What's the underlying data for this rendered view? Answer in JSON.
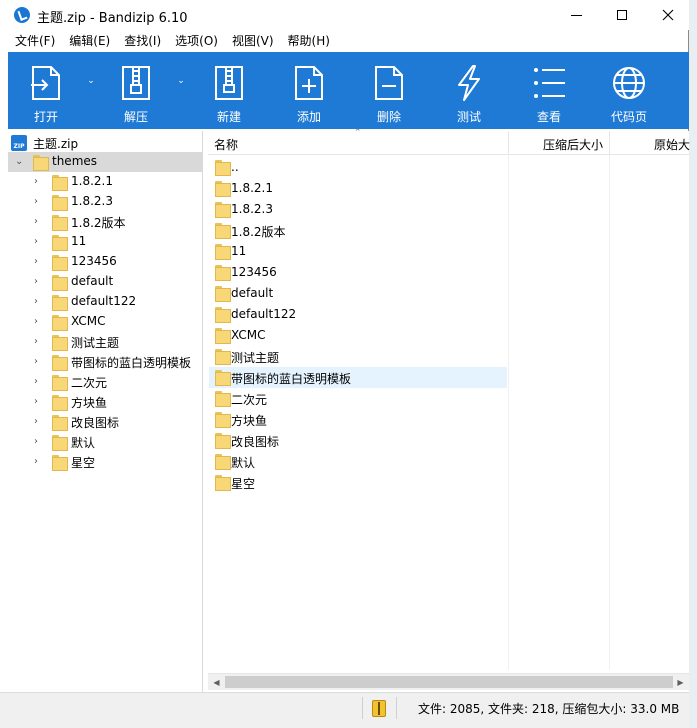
{
  "window": {
    "title": "主题.zip - Bandizip 6.10"
  },
  "menu": [
    "文件(F)",
    "编辑(E)",
    "查找(I)",
    "选项(O)",
    "视图(V)",
    "帮助(H)"
  ],
  "toolbar": {
    "open": "打开",
    "extract": "解压",
    "new": "新建",
    "add": "添加",
    "delete": "删除",
    "test": "测试",
    "view": "查看",
    "codepage": "代码页"
  },
  "tree": {
    "root": "主题.zip",
    "folder": "themes",
    "children": [
      "1.8.2.1",
      "1.8.2.3",
      "1.8.2版本",
      "11",
      "123456",
      "default",
      "default122",
      "XCMC",
      "测试主题",
      "带图标的蓝白透明模板",
      "二次元",
      "方块鱼",
      "改良图标",
      "默认",
      "星空"
    ]
  },
  "list": {
    "columns": {
      "name": "名称",
      "packed_size": "压缩后大小",
      "original_size": "原始大"
    },
    "rows": [
      "..",
      "1.8.2.1",
      "1.8.2.3",
      "1.8.2版本",
      "11",
      "123456",
      "default",
      "default122",
      "XCMC",
      "测试主题",
      "带图标的蓝白透明模板",
      "二次元",
      "方块鱼",
      "改良图标",
      "默认",
      "星空"
    ],
    "hover_row": "带图标的蓝白透明模板"
  },
  "status": {
    "text": "文件: 2085, 文件夹: 218, 压缩包大小: 33.0 MB"
  },
  "colors": {
    "toolbar": "#1e7ad5",
    "selection": "#d9d9d9",
    "hover": "#e5f3ff",
    "folder": "#f8d776"
  }
}
